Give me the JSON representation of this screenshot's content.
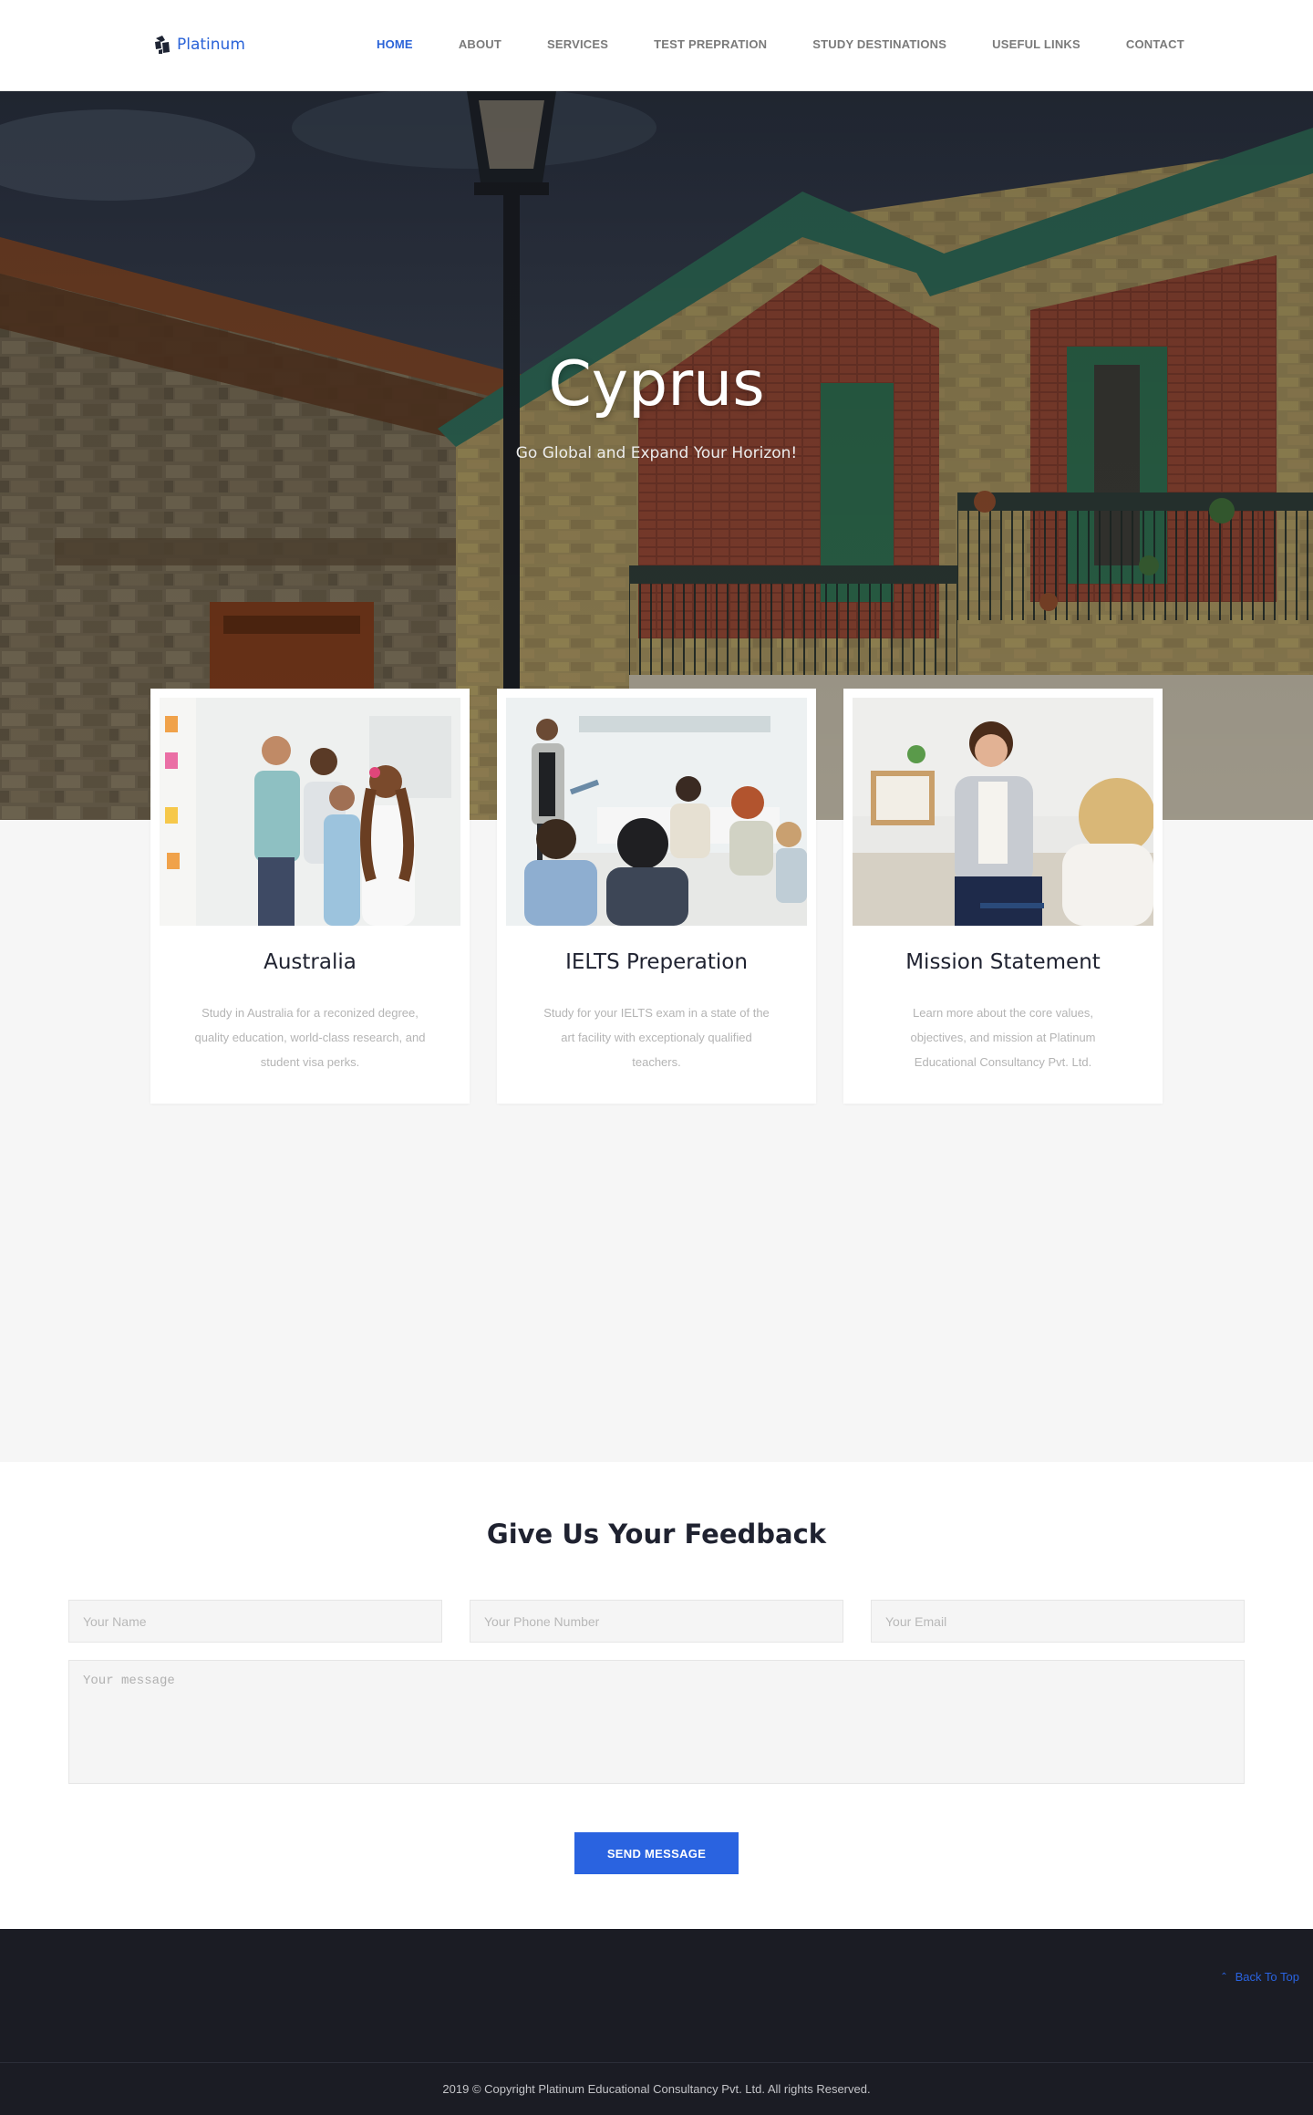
{
  "header": {
    "logo_text": "Platinum",
    "nav": [
      {
        "label": "HOME",
        "active": true
      },
      {
        "label": "ABOUT"
      },
      {
        "label": "SERVICES"
      },
      {
        "label": "TEST PREPRATION"
      },
      {
        "label": "STUDY DESTINATIONS"
      },
      {
        "label": "USEFUL LINKS"
      },
      {
        "label": "CONTACT"
      }
    ]
  },
  "hero": {
    "title": "Cyprus",
    "subtitle": "Go Global and Expand Your Horizon!"
  },
  "cards": [
    {
      "title": "Australia",
      "desc": "Study in Australia for a reconized degree, quality education, world-class research, and student visa perks."
    },
    {
      "title": "IELTS Preperation",
      "desc": "Study for your IELTS exam in a state of the art facility with exceptionaly qualified teachers."
    },
    {
      "title": "Mission Statement",
      "desc": "Learn more about the core values, objectives, and mission at Platinum Educational Consultancy Pvt. Ltd."
    }
  ],
  "feedback": {
    "title": "Give Us Your Feedback",
    "name_placeholder": "Your Name",
    "phone_placeholder": "Your Phone Number",
    "email_placeholder": "Your Email",
    "message_placeholder": "Your message",
    "send_label": "SEND MESSAGE"
  },
  "footer": {
    "back_to_top": "Back To Top",
    "copyright": "2019 © Copyright Platinum Educational Consultancy Pvt. Ltd. All rights Reserved."
  },
  "colors": {
    "accent": "#2a63e0",
    "footer_bg": "#1b1c24",
    "page_bg": "#f6f6f6"
  }
}
